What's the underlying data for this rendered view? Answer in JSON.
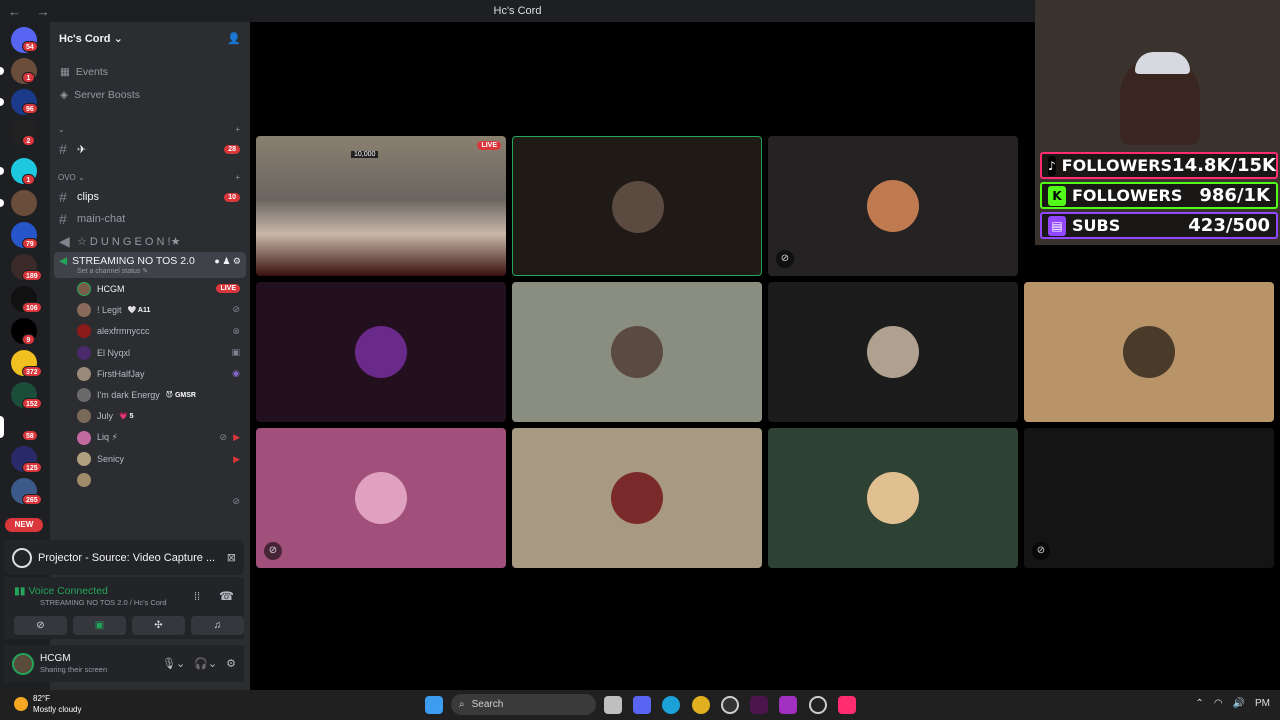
{
  "window": {
    "title": "Hc's Cord",
    "nav": "← →"
  },
  "rail": {
    "badges": [
      "54",
      "1",
      "96",
      "2",
      "1",
      "79",
      "189",
      "106",
      "9",
      "372",
      "152",
      "58",
      "125",
      "265"
    ],
    "new_label": "NEW"
  },
  "server": {
    "name": "Hc's Cord ⌄"
  },
  "menu": {
    "events": "Events",
    "boosts": "Server Boosts"
  },
  "categories": {
    "first": "⌄",
    "ovo": "OVO ⌄"
  },
  "channels": {
    "plane": {
      "label": "✈",
      "count": "28"
    },
    "clips": {
      "label": "clips",
      "count": "10"
    },
    "main_chat": "main-chat",
    "dungeon": "☆ D U N G E O N !★"
  },
  "voice_channel": {
    "name": "STREAMING NO TOS 2.0",
    "status": "Set a channel status ✎"
  },
  "voice_users": [
    {
      "name": "HCGM",
      "badge": "LIVE"
    },
    {
      "name": "! Legit",
      "badge": "🤍 A11"
    },
    {
      "name": "alexfrmnyccc",
      "badge": ""
    },
    {
      "name": "El Nyqxl",
      "badge": ""
    },
    {
      "name": "FirstHalfJay",
      "badge": ""
    },
    {
      "name": "I'm dark Energy",
      "badge": "😈 GMSR"
    },
    {
      "name": "July",
      "badge": "💗 5"
    },
    {
      "name": "Liq ⚡",
      "badge": ""
    },
    {
      "name": "Senicy",
      "badge": ""
    },
    {
      "name": "",
      "badge": ""
    }
  ],
  "projector": {
    "label": "Projector - Source: Video Capture ..."
  },
  "voice_connected": {
    "status": "Voice Connected",
    "location": "STREAMING NO TOS 2.0 / Hc's Cord"
  },
  "user": {
    "name": "HCGM",
    "status": "Sharing their screen"
  },
  "stream": {
    "live": "LIVE",
    "score": "10,000"
  },
  "overlay": {
    "tiktok": {
      "label": "FOLLOWERS",
      "value": "14.8K/15K",
      "color": "#ff2d6f"
    },
    "kick": {
      "label": "FOLLOWERS",
      "value": "986/1K",
      "color": "#53fc18"
    },
    "twitch": {
      "label": "SUBS",
      "value": "423/500",
      "color": "#9146ff"
    }
  },
  "weather": {
    "temp": "82°F",
    "desc": "Mostly cloudy"
  },
  "taskbar": {
    "search": "Search",
    "time": "PM"
  }
}
